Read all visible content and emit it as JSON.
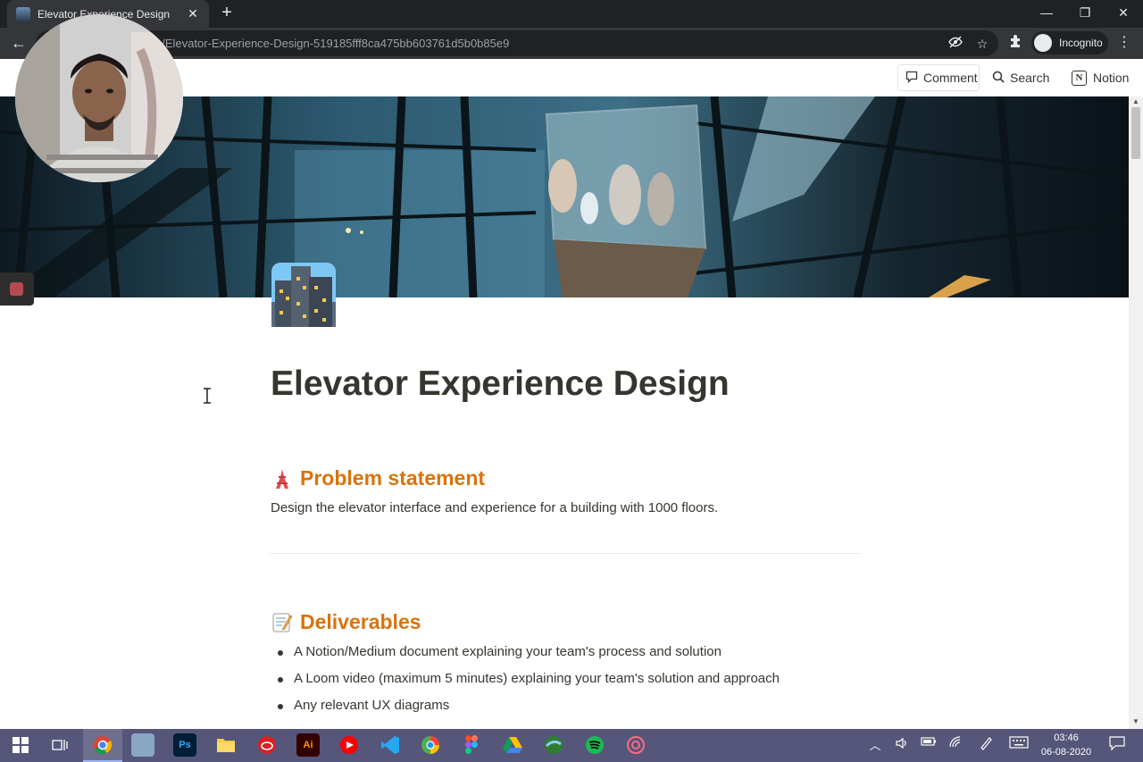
{
  "browser": {
    "tab_title": "Elevator Experience Design",
    "tab_close": "✕",
    "new_tab": "+",
    "window_controls": {
      "minimize": "—",
      "restore": "❐",
      "close": "✕"
    },
    "back": "←",
    "url": "o/Elevator-Experience-Design-519185fff8ca475bb603761d5b0b85e9",
    "profile_label": "Incognito",
    "menu": "⋮"
  },
  "notion_bar": {
    "comment": "Comment",
    "search": "Search",
    "notion": "Notion",
    "notion_badge": "N"
  },
  "page": {
    "title": "Elevator Experience Design",
    "sections": [
      {
        "heading": "Problem statement",
        "icon": "tower-emoji",
        "text": "Design the elevator interface and experience for a building with 1000 floors."
      },
      {
        "heading": "Deliverables",
        "icon": "memo-emoji",
        "bullets": [
          "A Notion/Medium document explaining your team's process and solution",
          "A Loom video (maximum 5 minutes) explaining your team's solution and approach",
          "Any relevant UX diagrams"
        ]
      }
    ]
  },
  "taskbar": {
    "apps": [
      "start",
      "task-view",
      "chrome",
      "photos",
      "photoshop",
      "file-explorer",
      "creative-cloud",
      "illustrator",
      "youtube",
      "vscode",
      "chrome-alt",
      "figma",
      "drive",
      "earth",
      "spotify",
      "app"
    ],
    "photoshop_label": "Ps",
    "illustrator_label": "Ai",
    "time": "03:46",
    "date": "06-08-2020",
    "notifications": "1"
  },
  "colors": {
    "heading_accent": "#d9730d",
    "text": "#37352f",
    "taskbar": "#55567a",
    "chrome_dark": "#202124"
  }
}
